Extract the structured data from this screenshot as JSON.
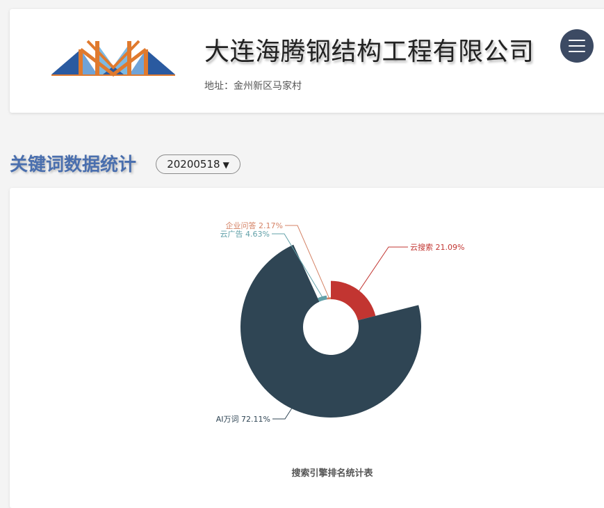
{
  "header": {
    "company_name": "大连海腾钢结构工程有限公司",
    "address": "地址：金州新区马家村"
  },
  "section": {
    "title": "关键词数据统计",
    "date_value": "20200518",
    "caret": "▼"
  },
  "colors": {
    "accent_title": "#4a6fae",
    "menu_bg": "#3c4a63"
  },
  "icons": {
    "menu": "hamburger-menu-icon",
    "logo": "company-logo"
  },
  "chart_data": {
    "type": "pie",
    "title": "搜索引擎排名统计表",
    "slices": [
      {
        "name": "云搜索",
        "value": 21.09,
        "label": "云搜索  21.09%",
        "color": "#c23531"
      },
      {
        "name": "AI万词",
        "value": 72.11,
        "label": "AI万词  72.11%",
        "color": "#2f4554"
      },
      {
        "name": "云广告",
        "value": 4.63,
        "label": "云广告  4.63%",
        "color": "#61a0a8"
      },
      {
        "name": "企业问答",
        "value": 2.17,
        "label": "企业问答  2.17%",
        "color": "#d48265"
      }
    ]
  }
}
